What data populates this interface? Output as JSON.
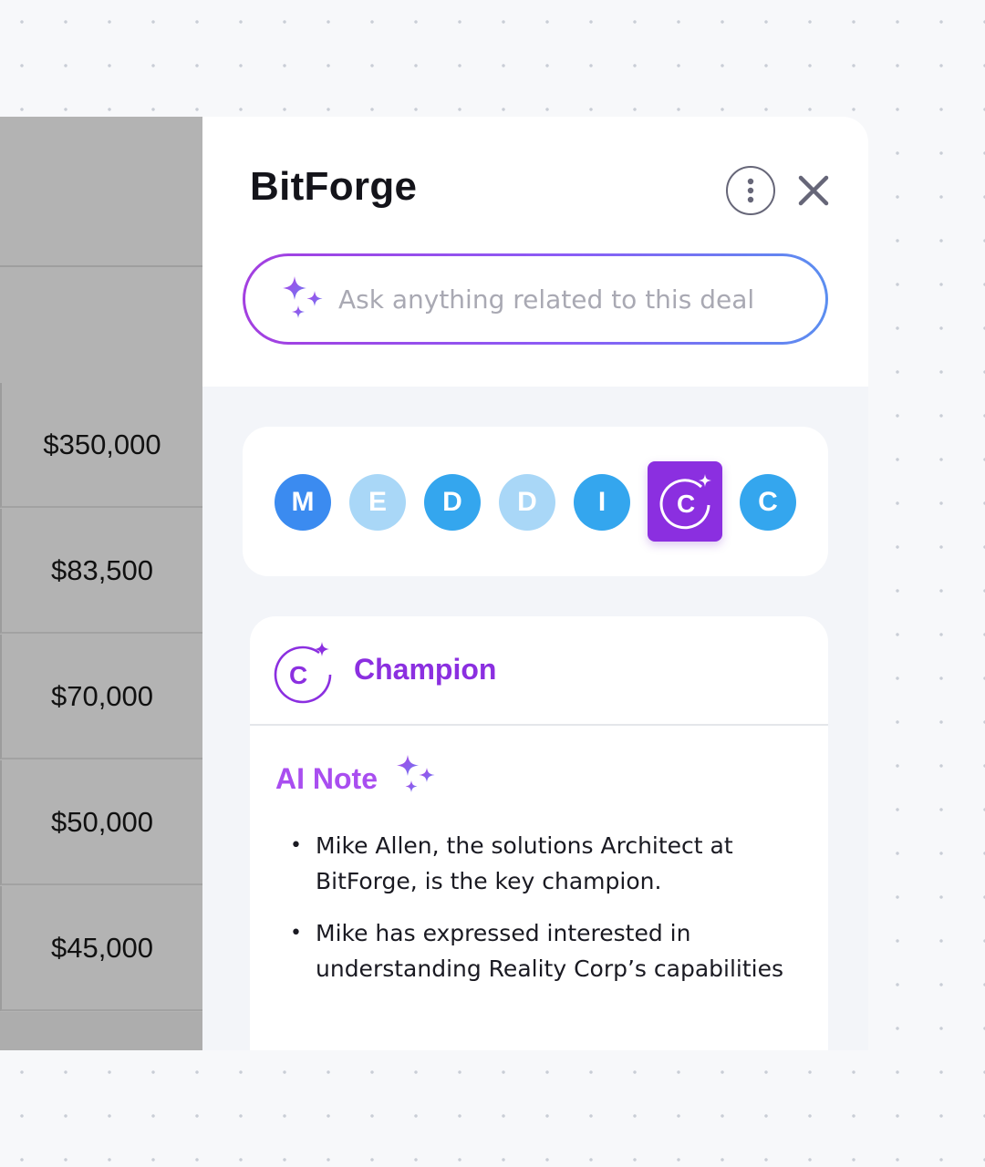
{
  "table": {
    "amounts": [
      "$350,000",
      "$83,500",
      "$70,000",
      "$50,000",
      "$45,000"
    ]
  },
  "deal": {
    "title": "BitForge",
    "more_icon": "more-vertical-icon",
    "close_icon": "close-icon"
  },
  "ask": {
    "placeholder": "Ask anything related to this deal",
    "icon": "sparkle-icon"
  },
  "meddic": {
    "letters": [
      {
        "letter": "M",
        "color": "#3b8bf0"
      },
      {
        "letter": "E",
        "color": "#a9d7f7"
      },
      {
        "letter": "D",
        "color": "#34a6ee"
      },
      {
        "letter": "D",
        "color": "#a9d7f7"
      },
      {
        "letter": "I",
        "color": "#34a6ee"
      },
      {
        "letter": "C",
        "color": "#8b2fe0",
        "active": true
      },
      {
        "letter": "C",
        "color": "#34a6ee"
      }
    ]
  },
  "champion": {
    "icon_letter": "C",
    "title": "Champion",
    "ai_note_title": "AI Note",
    "notes": [
      "Mike Allen, the solutions Architect at BitForge, is the key champion.",
      "Mike has expressed interested in understanding Reality Corp’s capabilities"
    ]
  },
  "colors": {
    "accent_purple": "#8b2fe0",
    "gradient_start": "#a33fe0",
    "gradient_end": "#5b8ef0"
  }
}
